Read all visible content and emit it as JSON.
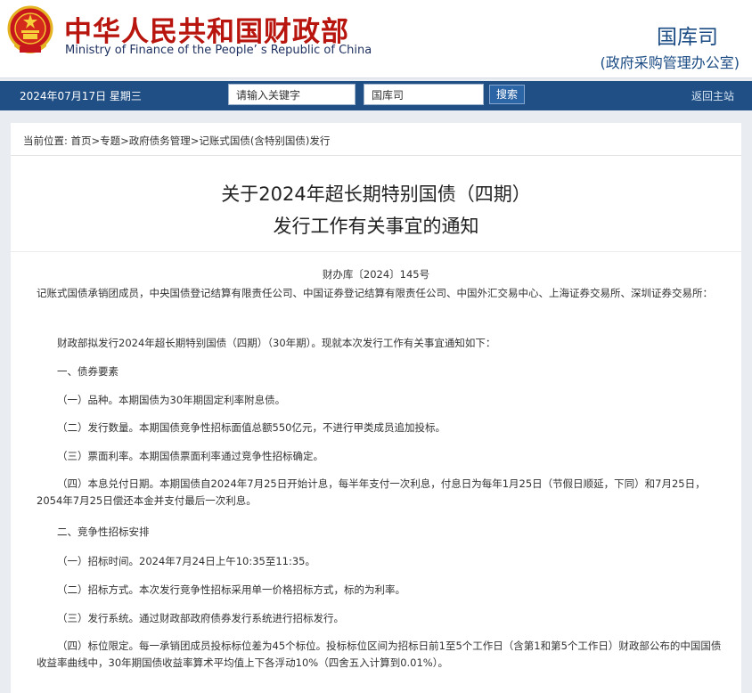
{
  "header": {
    "brand_cn": "中华人民共和国财政部",
    "brand_en": "Ministry of Finance of the People’ s Republic of China",
    "dept_name": "国库司",
    "dept_sub": "(政府采购管理办公室)"
  },
  "nav": {
    "date": "2024年07月17日  星期三",
    "keyword_placeholder": "请输入关键字",
    "dept_value": "国库司",
    "search_label": "搜索",
    "home_label": "返回主站"
  },
  "breadcrumb": "当前位置:  首页>专题>政府债务管理>记账式国债(含特别国债)发行",
  "article": {
    "title_line1": "关于2024年超长期特别国债（四期）",
    "title_line2": "发行工作有关事宜的通知",
    "doc_no": "财办库〔2024〕145号",
    "paragraphs": [
      "记账式国债承销团成员，中央国债登记结算有限责任公司、中国证券登记结算有限责任公司、中国外汇交易中心、上海证券交易所、深圳证券交易所：",
      "财政部拟发行2024年超长期特别国债（四期）（30年期）。现就本次发行工作有关事宜通知如下：",
      "一、债券要素",
      "（一）品种。本期国债为30年期固定利率附息债。",
      "（二）发行数量。本期国债竞争性招标面值总额550亿元，不进行甲类成员追加投标。",
      "（三）票面利率。本期国债票面利率通过竞争性招标确定。",
      "（四）本息兑付日期。本期国债自2024年7月25日开始计息，每半年支付一次利息，付息日为每年1月25日（节假日顺延，下同）和7月25日，2054年7月25日偿还本金并支付最后一次利息。",
      "二、竞争性招标安排",
      "（一）招标时间。2024年7月24日上午10:35至11:35。",
      "（二）招标方式。本次发行竞争性招标采用单一价格招标方式，标的为利率。",
      "（三）发行系统。通过财政部政府债券发行系统进行招标发行。",
      "（四）标位限定。每一承销团成员投标标位差为45个标位。投标标位区间为招标日前1至5个工作日（含第1和第5个工作日）财政部公布的中国国债收益率曲线中，30年期国债收益率算术平均值上下各浮动10%（四舍五入计算到0.01%）。"
    ]
  },
  "colors": {
    "brand_red": "#b8150e",
    "nav_blue": "#1f4f85",
    "dept_blue": "#1c4c84"
  }
}
